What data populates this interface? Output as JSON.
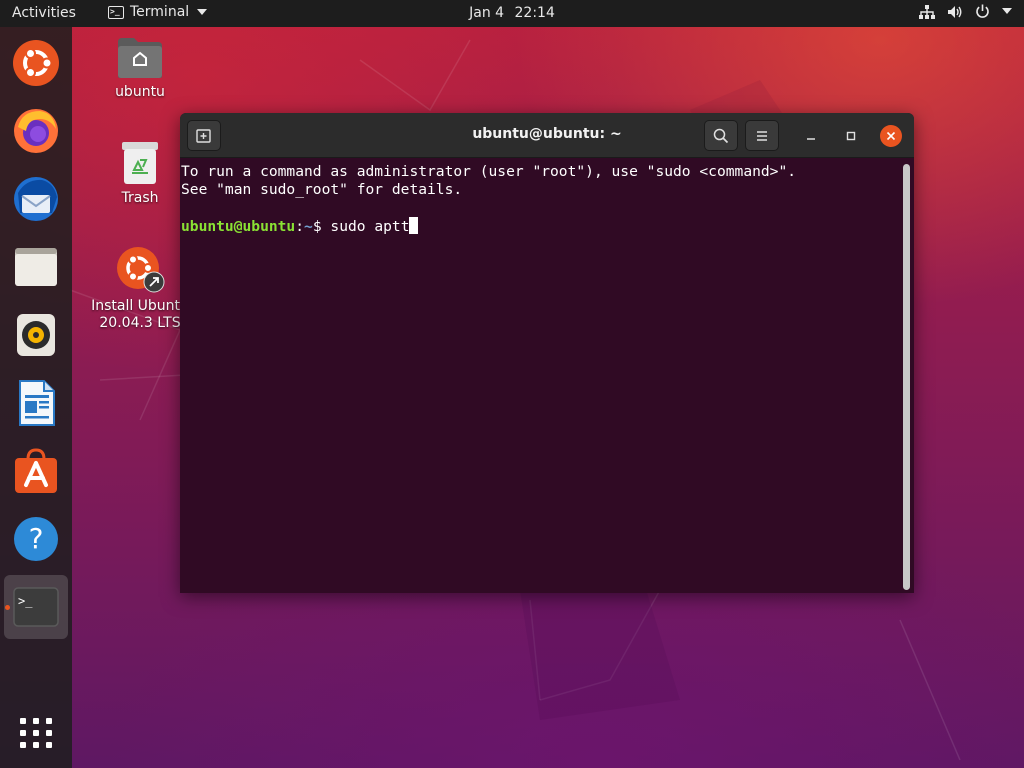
{
  "topbar": {
    "activities": "Activities",
    "app_name": "Terminal",
    "date": "Jan 4",
    "time": "22:14",
    "tray_icons": [
      "network-icon",
      "volume-icon",
      "power-icon",
      "chevron-down-icon"
    ]
  },
  "dock": {
    "items": [
      {
        "name": "ubuntu-logo-icon"
      },
      {
        "name": "firefox-icon"
      },
      {
        "name": "thunderbird-icon"
      },
      {
        "name": "files-icon"
      },
      {
        "name": "rhythmbox-icon"
      },
      {
        "name": "libreoffice-writer-icon"
      },
      {
        "name": "ubuntu-software-icon"
      },
      {
        "name": "help-icon"
      },
      {
        "name": "terminal-icon",
        "active": true
      }
    ],
    "show_apps_icon": "app-grid-icon"
  },
  "desktop": {
    "icons": [
      {
        "label": "ubuntu"
      },
      {
        "label": "Trash"
      },
      {
        "label_line1": "Install Ubuntu",
        "label_line2": "20.04.3 LTS"
      }
    ]
  },
  "terminal": {
    "title": "ubuntu@ubuntu: ~",
    "lines": [
      "To run a command as administrator (user \"root\"), use \"sudo <command>\".",
      "See \"man sudo_root\" for details."
    ],
    "prompt_user": "ubuntu@ubuntu",
    "prompt_sep": ":",
    "prompt_path": "~",
    "prompt_symbol": "$ ",
    "command": "sudo aptt"
  },
  "colors": {
    "accent": "#e95420",
    "terminal_bg": "#300a24",
    "prompt_user": "#8ae234",
    "prompt_path": "#729fcf"
  }
}
